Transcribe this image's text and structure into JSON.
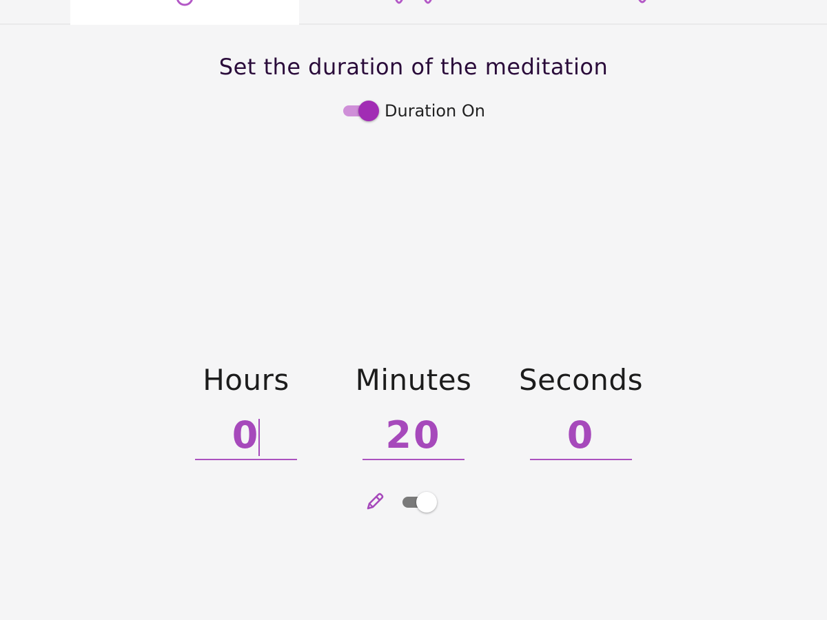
{
  "tabs": [
    {
      "icon": "meditation-timer-icon",
      "active": true
    },
    {
      "icon": "history-icon",
      "active": false
    },
    {
      "icon": "settings-icon",
      "active": false
    }
  ],
  "heading": "Set the duration of the meditation",
  "duration_toggle": {
    "label": "Duration On",
    "checked": true
  },
  "time": {
    "hours": {
      "label": "Hours",
      "value": "0"
    },
    "minutes": {
      "label": "Minutes",
      "value": "20"
    },
    "seconds": {
      "label": "Seconds",
      "value": "0"
    }
  },
  "controls": {
    "edit_icon": "pencil-icon",
    "secondary_toggle": {
      "checked": false
    }
  },
  "colors": {
    "accent": "#a12cb4",
    "accent_light": "#cf8fd8",
    "value_text": "#a649bb",
    "heading_text": "#2a0b3a",
    "background": "#f5f5f6"
  }
}
